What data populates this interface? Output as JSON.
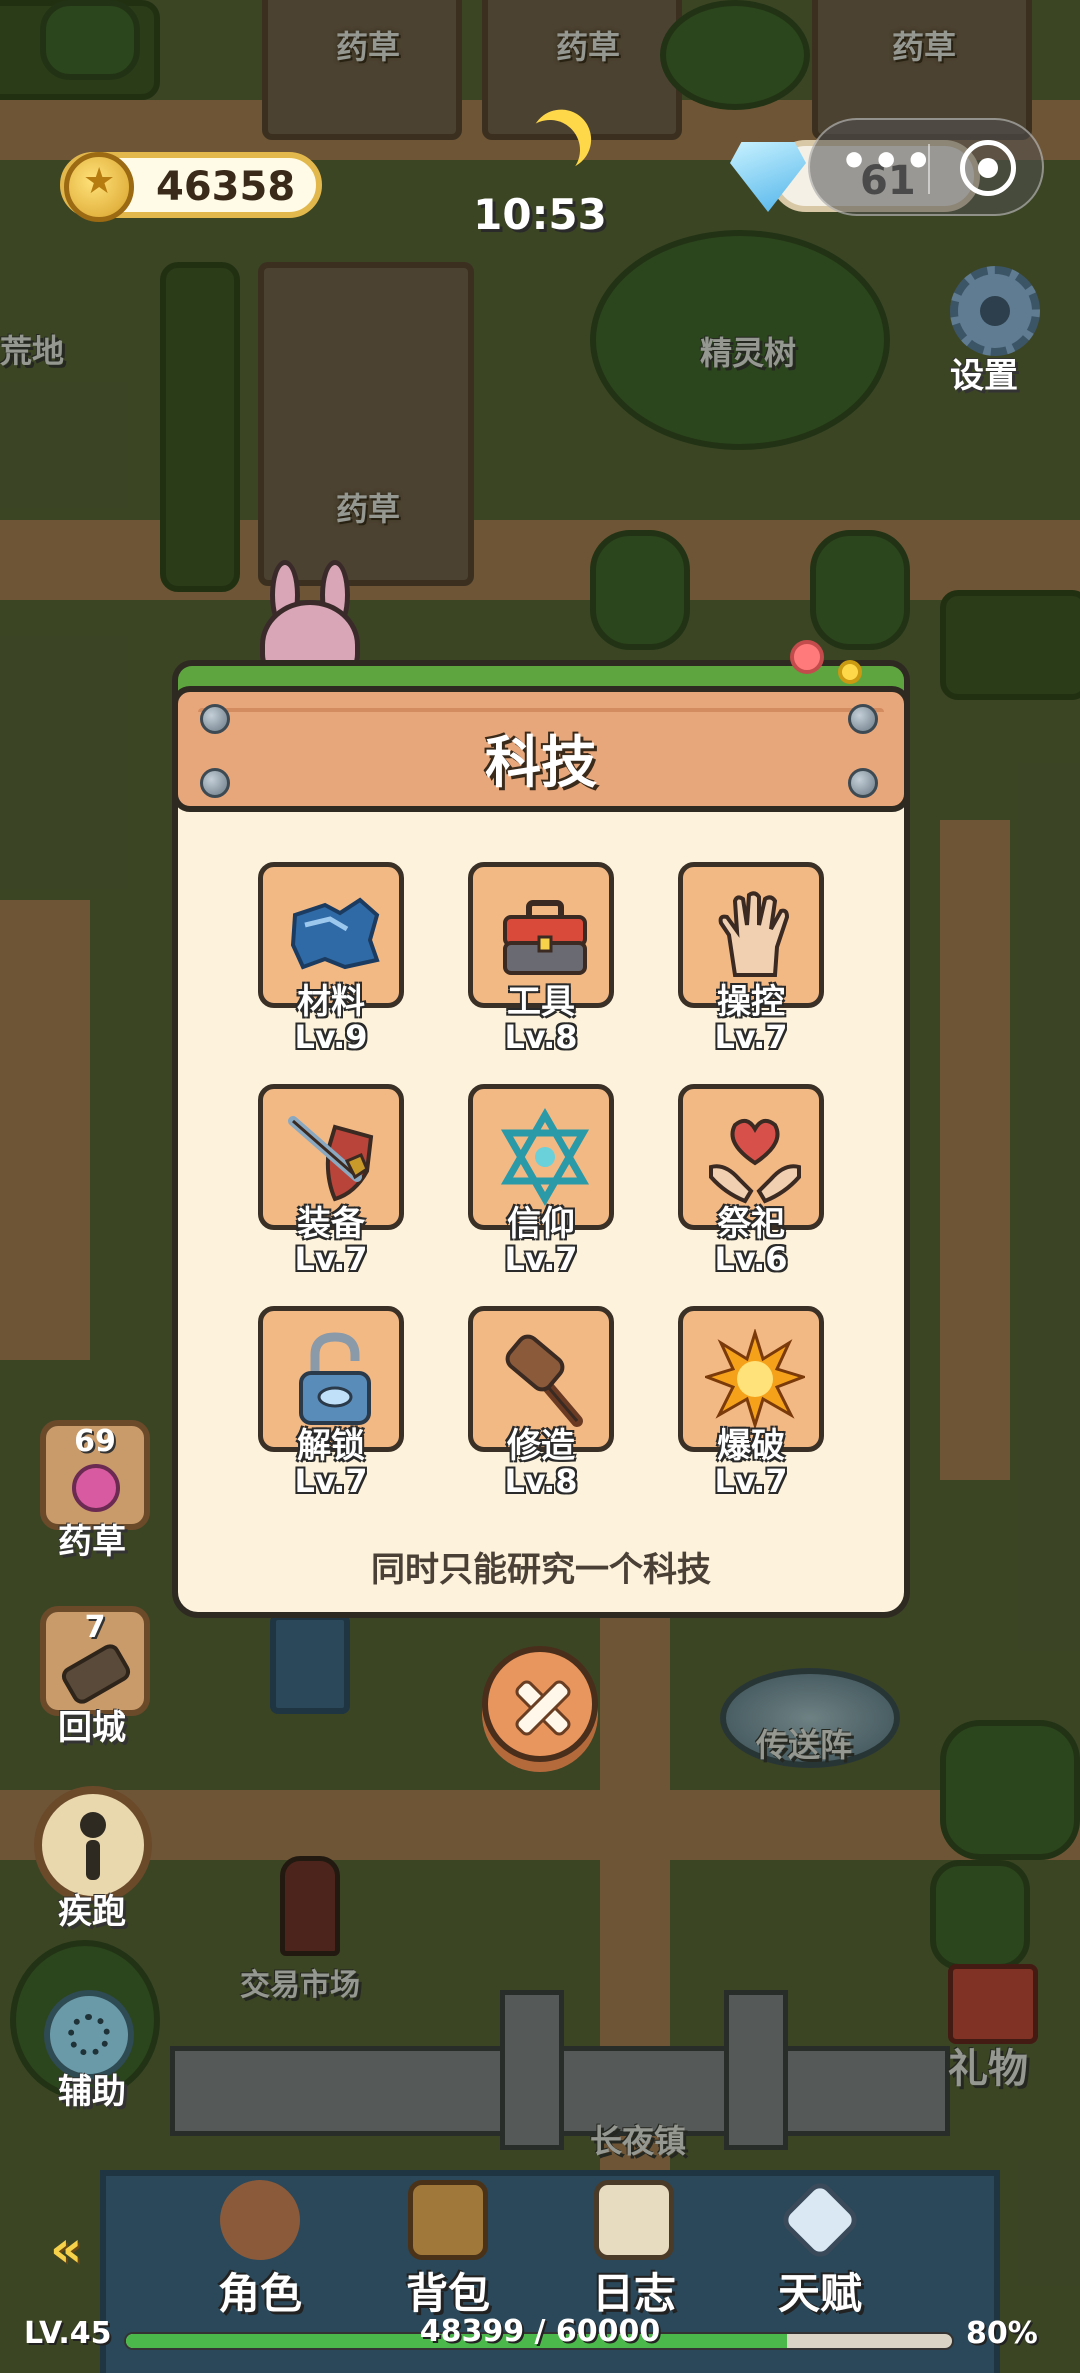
{
  "hud": {
    "coins": "46358",
    "time": "10:53",
    "gems": "61",
    "settings_label": "设置"
  },
  "map_labels": {
    "herb_1": "药草",
    "herb_2": "药草",
    "herb_3": "药草",
    "herb_4": "药草",
    "wasteland": "荒地",
    "spirit_tree": "精灵树",
    "portal": "传送阵",
    "market": "交易市场",
    "town": "长夜镇"
  },
  "side_buttons": {
    "herb": {
      "label": "药草",
      "count": "69"
    },
    "return_city": {
      "label": "回城",
      "count": "7"
    },
    "sprint": {
      "label": "疾跑"
    },
    "assist": {
      "label": "辅助"
    },
    "gift": {
      "label": "礼物"
    }
  },
  "modal": {
    "title": "科技",
    "note": "同时只能研究一个科技",
    "items": [
      {
        "name": "材料",
        "level": "Lv.9",
        "icon": "material-icon"
      },
      {
        "name": "工具",
        "level": "Lv.8",
        "icon": "toolbox-icon"
      },
      {
        "name": "操控",
        "level": "Lv.7",
        "icon": "hand-icon"
      },
      {
        "name": "装备",
        "level": "Lv.7",
        "icon": "sword-shield-icon"
      },
      {
        "name": "信仰",
        "level": "Lv.7",
        "icon": "star-of-david-icon"
      },
      {
        "name": "祭祀",
        "level": "Lv.6",
        "icon": "heart-hands-icon"
      },
      {
        "name": "解锁",
        "level": "Lv.7",
        "icon": "padlock-icon"
      },
      {
        "name": "修造",
        "level": "Lv.8",
        "icon": "hammer-icon"
      },
      {
        "name": "爆破",
        "level": "Lv.7",
        "icon": "explosion-icon"
      }
    ]
  },
  "bottom_nav": [
    {
      "label": "角色",
      "icon": "character-icon"
    },
    {
      "label": "背包",
      "icon": "backpack-icon"
    },
    {
      "label": "日志",
      "icon": "book-icon"
    },
    {
      "label": "天赋",
      "icon": "winged-gem-icon"
    }
  ],
  "player": {
    "level": "LV.45",
    "xp": "48399 / 60000",
    "xp_percent": "80%",
    "xp_fraction": 0.8
  },
  "colors": {
    "tile": "#f3b985",
    "header": "#e8a77a",
    "panel": "#fdf3dc",
    "xp_fill": "#4bb84b"
  }
}
